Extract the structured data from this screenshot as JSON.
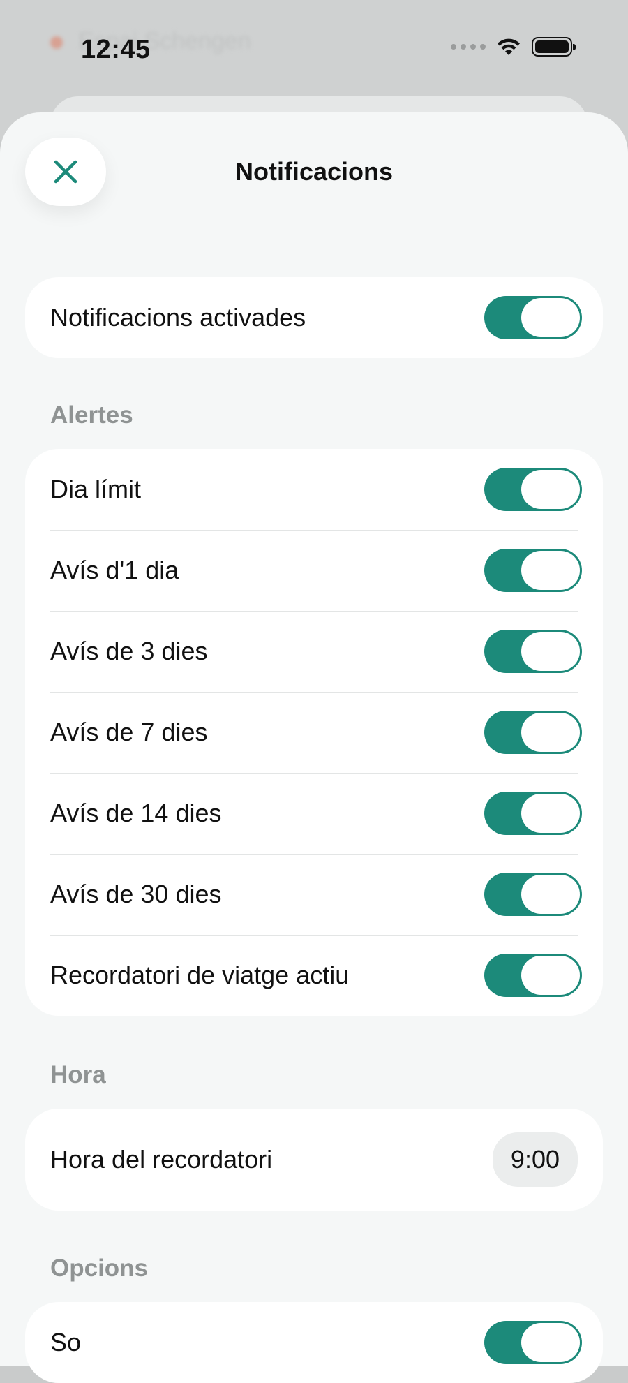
{
  "status_bar": {
    "time": "12:45"
  },
  "background": {
    "row1": "Espai Schengen"
  },
  "sheet": {
    "title": "Notificacions"
  },
  "main_toggle": {
    "label": "Notificacions activades",
    "on": true
  },
  "alerts": {
    "header": "Alertes",
    "items": [
      {
        "label": "Dia límit",
        "on": true
      },
      {
        "label": "Avís d'1 dia",
        "on": true
      },
      {
        "label": "Avís de 3 dies",
        "on": true
      },
      {
        "label": "Avís de 7 dies",
        "on": true
      },
      {
        "label": "Avís de 14 dies",
        "on": true
      },
      {
        "label": "Avís de 30 dies",
        "on": true
      },
      {
        "label": "Recordatori de viatge actiu",
        "on": true
      }
    ]
  },
  "time": {
    "header": "Hora",
    "label": "Hora del recordatori",
    "value": "9:00"
  },
  "options": {
    "header": "Opcions",
    "items": [
      {
        "label": "So",
        "on": true
      }
    ]
  },
  "colors": {
    "accent": "#1c8a7a",
    "sheet_bg": "#f5f7f7",
    "card_bg": "#ffffff"
  },
  "icons": {
    "close": "close-icon",
    "wifi": "wifi-icon",
    "battery": "battery-icon"
  }
}
